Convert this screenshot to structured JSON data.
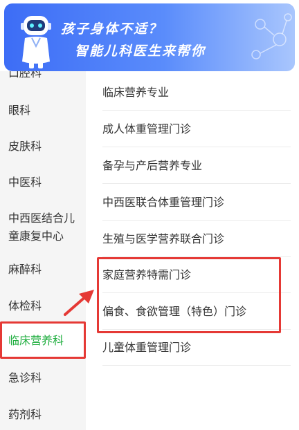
{
  "banner": {
    "line1": "孩子身体不适？",
    "line2": "智能儿科医生来帮你"
  },
  "sidebar": {
    "items": [
      {
        "label": "口腔科"
      },
      {
        "label": "眼科"
      },
      {
        "label": "皮肤科"
      },
      {
        "label": "中医科"
      },
      {
        "label": "中西医结合儿"
      },
      {
        "label": "童康复中心"
      },
      {
        "label": "麻醉科"
      },
      {
        "label": "体检科"
      },
      {
        "label": "临床营养科"
      },
      {
        "label": "急诊科"
      },
      {
        "label": "药剂科"
      }
    ]
  },
  "clinics": {
    "items": [
      {
        "label": "临床营养专业"
      },
      {
        "label": "成人体重管理门诊"
      },
      {
        "label": "备孕与产后营养专业"
      },
      {
        "label": "中西医联合体重管理门诊"
      },
      {
        "label": "生殖与医学营养联合门诊"
      },
      {
        "label": "家庭营养特需门诊"
      },
      {
        "label": "偏食、食欲管理（特色）门诊"
      },
      {
        "label": "儿童体重管理门诊"
      }
    ]
  },
  "colors": {
    "active_text": "#1fae3f",
    "highlight_box": "#e53935",
    "banner_start": "#3d6df6"
  }
}
